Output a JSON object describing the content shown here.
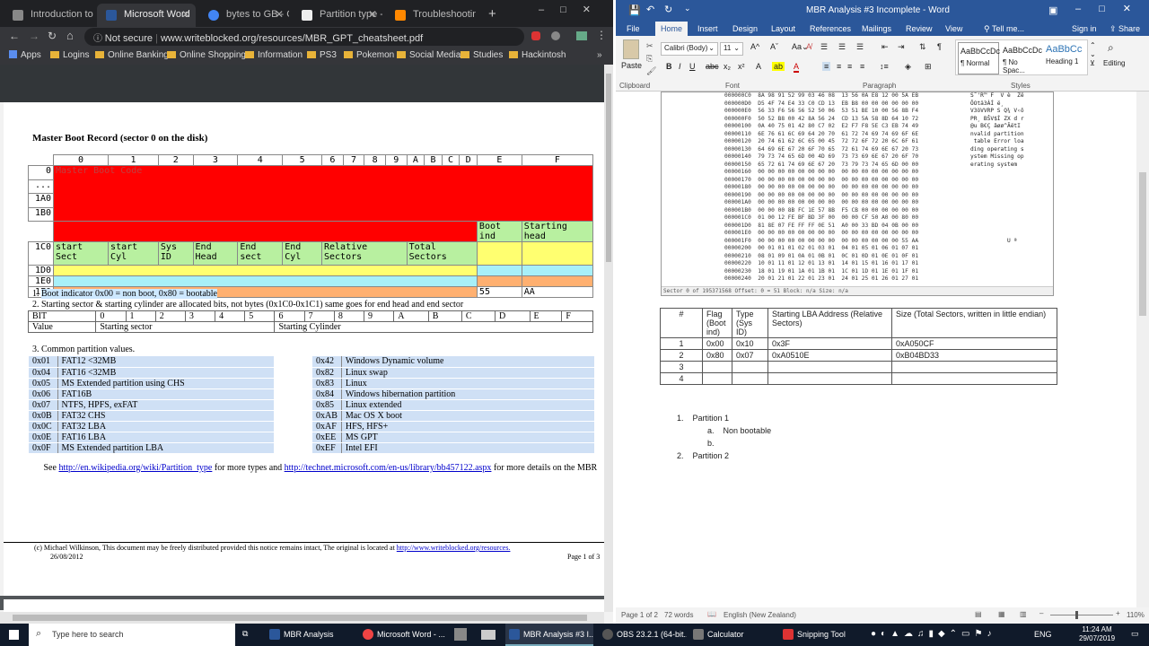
{
  "browser": {
    "tabs": [
      {
        "label": "Introduction to P..."
      },
      {
        "label": "Microsoft Word"
      },
      {
        "label": "bytes to GB - Goo..."
      },
      {
        "label": "Partition type - W..."
      },
      {
        "label": "Troubleshooting"
      }
    ],
    "security": "Not secure",
    "url": "www.writeblocked.org/resources/MBR_GPT_cheatsheet.pdf",
    "bookmarks": [
      "Apps",
      "Logins",
      "Online Banking",
      "Online Shopping",
      "Information",
      "PS3",
      "Pokemon",
      "Social Media",
      "Studies",
      "Hackintosh"
    ]
  },
  "pdf": {
    "title": "Master Boot Record (sector 0 on the disk)",
    "header_cols": [
      "0",
      "1",
      "2",
      "3",
      "4",
      "5",
      "6",
      "7",
      "8",
      "9",
      "A",
      "B",
      "C",
      "D",
      "E",
      "F"
    ],
    "row_labels": [
      "0",
      "...",
      "1A0",
      "1B0",
      "1C0",
      "1D0",
      "1E0",
      "1F0"
    ],
    "master_boot_code": "Master Boot Code",
    "boot_ind": "Boot ind",
    "starting_head": "Starting head",
    "start_sect": "start Sect",
    "start_cyl": "start Cyl",
    "sys_id": "Sys ID",
    "end_head": "End Head",
    "end_sect": "End sect",
    "end_cyl": "End Cyl",
    "relative_sectors": "Relative Sectors",
    "total_sectors": "Total Sectors",
    "sig1": "55",
    "sig2": "AA",
    "note1": "Boot indicator 0x00 = non boot, 0x80 = bootable",
    "note2": "2.  Starting sector & starting cylinder are allocated bits, not bytes  (0x1C0-0x1C1)  same goes for end head and end sector",
    "bit_label": "BIT",
    "bit_cols": [
      "0",
      "1",
      "2",
      "3",
      "4",
      "5",
      "6",
      "7",
      "8",
      "9",
      "A",
      "B",
      "C",
      "D",
      "E",
      "F"
    ],
    "value_label": "Value",
    "starting_sector": "Starting sector",
    "starting_cylinder": "Starting Cylinder",
    "note3": "3.  Common partition values.",
    "types_left": [
      [
        "0x01",
        "FAT12 <32MB"
      ],
      [
        "0x04",
        "FAT16 <32MB"
      ],
      [
        "0x05",
        "MS Extended partition using CHS"
      ],
      [
        "0x06",
        "FAT16B"
      ],
      [
        "0x07",
        "NTFS, HPFS, exFAT"
      ],
      [
        "0x0B",
        "FAT32 CHS"
      ],
      [
        "0x0C",
        "FAT32 LBA"
      ],
      [
        "0x0E",
        "FAT16 LBA"
      ],
      [
        "0x0F",
        "MS Extended partition LBA"
      ]
    ],
    "types_right": [
      [
        "0x42",
        "Windows Dynamic volume"
      ],
      [
        "0x82",
        "Linux swap"
      ],
      [
        "0x83",
        "Linux"
      ],
      [
        "0x84",
        "Windows hibernation partition"
      ],
      [
        "0x85",
        "Linux extended"
      ],
      [
        "0xAB",
        "Mac OS X boot"
      ],
      [
        "0xAF",
        "HFS, HFS+"
      ],
      [
        "0xEE",
        "MS GPT"
      ],
      [
        "0xEF",
        "Intel EFI"
      ]
    ],
    "see": "See",
    "link1": "http://en.wikipedia.org/wiki/Partition_type",
    "for_more": "for more types and",
    "link2": "http://technet.microsoft.com/en-us/library/bb457122.aspx",
    "for_more2": "for more details on the MBR",
    "copyright": "(c) Michael Wilkinson, This document may be freely distributed provided this notice remains intact, The original is located at",
    "copyright_link": "http://www.writeblocked.org/resources.",
    "date": "26/08/2012",
    "page": "Page 1 of 3"
  },
  "word": {
    "title": "MBR Analysis #3 Incomplete - Word",
    "tabs": [
      "File",
      "Home",
      "Insert",
      "Design",
      "Layout",
      "References",
      "Mailings",
      "Review",
      "View",
      "Tell me...",
      "Sign in",
      "Share"
    ],
    "font": "Calibri (Body)",
    "size": "11",
    "styles": [
      "AaBbCcDc",
      "AaBbCcDc",
      "AaBbCc"
    ],
    "style_names": [
      "¶ Normal",
      "¶ No Spac...",
      "Heading 1"
    ],
    "groups": [
      "Clipboard",
      "Font",
      "Paragraph",
      "Styles",
      "Editing"
    ],
    "paste": "Paste",
    "hex_lines": [
      "000000C0  8A 98 91 52 99 03 46 08  13 56 0A E8 12 00 5A EB",
      "000000D0  D5 4F 74 E4 33 C0 CD 13  EB B8 00 00 00 00 00 00",
      "000000E0  56 33 F6 56 56 52 50 06  53 51 BE 10 00 56 8B F4",
      "000000F0  50 52 B8 00 42 8A 56 24  CD 13 5A 58 8D 64 10 72",
      "00000100  0A 40 75 01 42 80 C7 02  E2 F7 F8 5E C3 EB 74 49",
      "00000110  6E 76 61 6C 69 64 20 70  61 72 74 69 74 69 6F 6E",
      "00000120  20 74 61 62 6C 65 00 45  72 72 6F 72 20 6C 6F 61",
      "00000130  64 69 6E 67 20 6F 70 65  72 61 74 69 6E 67 20 73",
      "00000140  79 73 74 65 6D 00 4D 69  73 73 69 6E 67 20 6F 70",
      "00000150  65 72 61 74 69 6E 67 20  73 79 73 74 65 6D 00 00",
      "00000160  00 00 00 00 00 00 00 00  00 00 00 00 00 00 00 00",
      "00000170  00 00 00 00 00 00 00 00  00 00 00 00 00 00 00 00",
      "00000180  00 00 00 00 00 00 00 00  00 00 00 00 00 00 00 00",
      "00000190  00 00 00 00 00 00 00 00  00 00 00 00 00 00 00 00",
      "000001A0  00 00 00 00 00 00 00 00  00 00 00 00 00 00 00 00",
      "000001B0  00 00 00 8B FC 1E 57 8B  F5 CB 00 00 00 00 00 00",
      "000001C0  01 00 12 FE BF BD 3F 00  00 00 CF 50 A0 00 80 00",
      "000001D0  81 8E 07 FE FF FF 0E 51  A0 00 33 BD 04 0B 00 00",
      "000001E0  00 00 00 00 00 00 00 00  00 00 00 00 00 00 00 00",
      "000001F0  00 00 00 00 00 00 00 00  00 00 00 00 00 00 55 AA",
      "00000200  00 01 01 01 02 01 03 01  04 01 05 01 06 01 07 01",
      "00000210  08 01 09 01 0A 01 0B 01  0C 01 0D 01 0E 01 0F 01",
      "00000220  10 01 11 01 12 01 13 01  14 01 15 01 16 01 17 01",
      "00000230  18 01 19 01 1A 01 1B 01  1C 01 1D 01 1E 01 1F 01",
      "00000240  20 01 21 01 22 01 23 01  24 01 25 01 26 01 27 01"
    ],
    "hex_ascii": [
      "Š˜'R™ F  V è  Zë",
      "ÕOtä3ÀÍ ë¸",
      "V3öVVRP S Q¾ V‹ô",
      "PR¸ BŠV$Í ZX d r",
      "@u B€Ç âøø^ÃëtI",
      "nvalid partition",
      " table Error loa",
      "ding operating s",
      "ystem Missing op",
      "erating system",
      "",
      "",
      "",
      "",
      "",
      "",
      "",
      "",
      "",
      "           U ª",
      "",
      "",
      "",
      "",
      ""
    ],
    "hex_status": "Sector 0 of 195371568   Offset: 0   = 51   Block: n/a   Size: n/a",
    "table_headers": [
      "#",
      "Flag (Boot ind)",
      "Type (Sys ID)",
      "Starting LBA Address (Relative Sectors)",
      "Size (Total Sectors, written in little endian)"
    ],
    "table_rows": [
      [
        "1",
        "0x00",
        "0x10",
        "0x3F",
        "0xA050CF"
      ],
      [
        "2",
        "0x80",
        "0x07",
        "0xA0510E",
        "0xB04BD33"
      ],
      [
        "3",
        "",
        "",
        "",
        ""
      ],
      [
        "4",
        "",
        "",
        "",
        ""
      ]
    ],
    "list": [
      {
        "num": "1.",
        "text": "Partition 1"
      },
      {
        "num": "a.",
        "text": "Non bootable"
      },
      {
        "num": "b.",
        "text": ""
      },
      {
        "num": "2.",
        "text": "Partition 2"
      }
    ],
    "status_page": "Page 1 of 2",
    "status_words": "72 words",
    "status_lang": "English (New Zealand)",
    "zoom": "110%"
  },
  "taskbar": {
    "search": "Type here to search",
    "items": [
      "MBR Analysis",
      "Microsoft Word - ...",
      "MBR Analysis #3 I...",
      "OBS 23.2.1 (64-bit...",
      "Calculator",
      "Snipping Tool"
    ],
    "lang": "ENG",
    "time": "11:24 AM",
    "date": "29/07/2019"
  }
}
